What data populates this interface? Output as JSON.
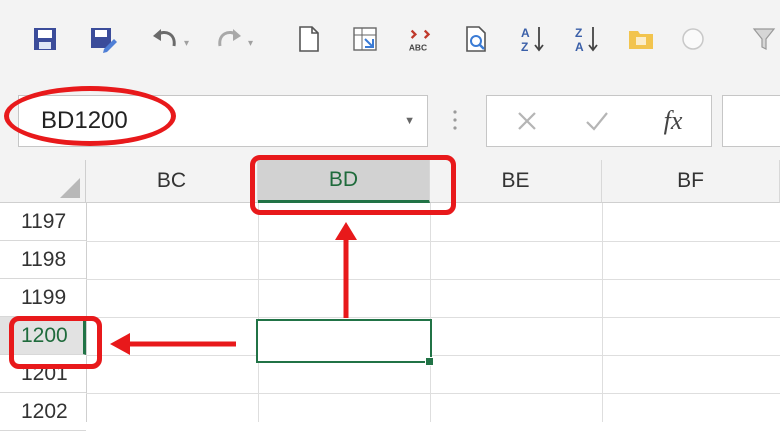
{
  "toolbar": {
    "icons": [
      "save-icon",
      "save-as-icon",
      "undo-icon",
      "redo-icon",
      "new-document-icon",
      "table-icon",
      "spelling-icon",
      "print-preview-icon",
      "sort-ascending-icon",
      "sort-descending-icon",
      "folder-icon",
      "circle-icon",
      "filter-icon"
    ]
  },
  "formula_bar": {
    "name_box_value": "BD1200",
    "fx_label": "fx"
  },
  "grid": {
    "columns": [
      "BC",
      "BD",
      "BE",
      "BF"
    ],
    "selected_column": "BD",
    "rows": [
      "1197",
      "1198",
      "1199",
      "1200",
      "1201",
      "1202"
    ],
    "selected_row": "1200",
    "active_cell": "BD1200"
  },
  "colors": {
    "excel_green": "#217346",
    "annotation_red": "#e8191b",
    "toolbar_bg": "#f3f3f3"
  }
}
